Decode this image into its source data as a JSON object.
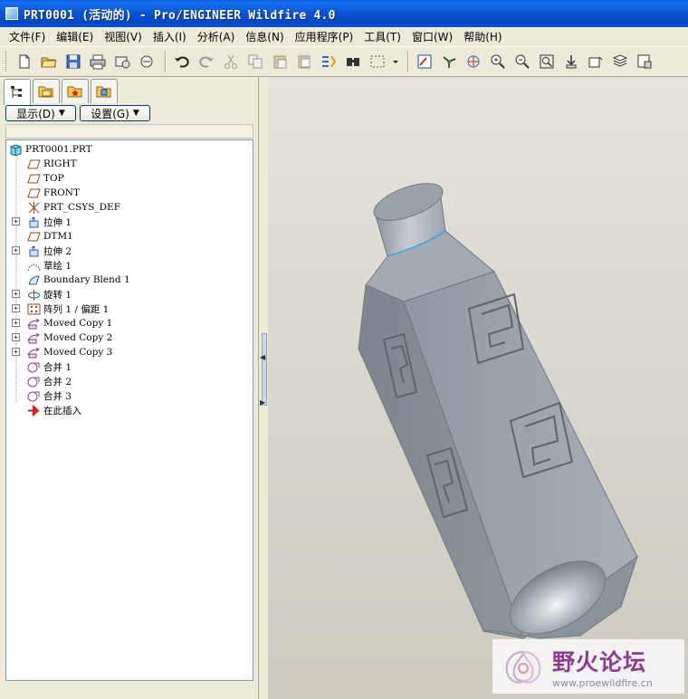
{
  "window": {
    "title": "PRT0001 (活动的) - Pro/ENGINEER Wildfire 4.0"
  },
  "menu": [
    {
      "label": "文件(F)"
    },
    {
      "label": "编辑(E)"
    },
    {
      "label": "视图(V)"
    },
    {
      "label": "插入(I)"
    },
    {
      "label": "分析(A)"
    },
    {
      "label": "信息(N)"
    },
    {
      "label": "应用程序(P)"
    },
    {
      "label": "工具(T)"
    },
    {
      "label": "窗口(W)"
    },
    {
      "label": "帮助(H)"
    }
  ],
  "toolbar_icons": [
    "new-icon",
    "open-icon",
    "save-icon",
    "print-icon",
    "send-icon",
    "email-icon",
    "undo-icon",
    "redo-icon",
    "cut-icon",
    "copy-icon",
    "paste-icon",
    "paste-special-icon",
    "regenerate-icon",
    "find-icon",
    "select-box-icon",
    "repaint-icon",
    "spin-center-icon",
    "orient-icon",
    "zoom-in-icon",
    "zoom-out-icon",
    "refit-icon",
    "reorient-icon",
    "saved-views-icon",
    "layers-icon",
    "view-manager-icon"
  ],
  "tree_controls": {
    "show_label": "显示(D)",
    "settings_label": "设置(G)"
  },
  "tree": {
    "root": "PRT0001.PRT",
    "items": [
      {
        "label": "RIGHT",
        "icon": "datum-plane-icon",
        "expandable": false
      },
      {
        "label": "TOP",
        "icon": "datum-plane-icon",
        "expandable": false
      },
      {
        "label": "FRONT",
        "icon": "datum-plane-icon",
        "expandable": false
      },
      {
        "label": "PRT_CSYS_DEF",
        "icon": "csys-icon",
        "expandable": false
      },
      {
        "label": "拉伸 1",
        "icon": "extrude-icon",
        "expandable": true
      },
      {
        "label": "DTM1",
        "icon": "datum-plane-icon",
        "expandable": false
      },
      {
        "label": "拉伸 2",
        "icon": "extrude-icon",
        "expandable": true
      },
      {
        "label": "草绘 1",
        "icon": "sketch-icon",
        "expandable": false
      },
      {
        "label": "Boundary Blend 1",
        "icon": "boundary-blend-icon",
        "expandable": false
      },
      {
        "label": "旋转 1",
        "icon": "revolve-icon",
        "expandable": true
      },
      {
        "label": "阵列 1 / 偏距 1",
        "icon": "pattern-icon",
        "expandable": true
      },
      {
        "label": "Moved Copy 1",
        "icon": "moved-copy-icon",
        "expandable": true
      },
      {
        "label": "Moved Copy 2",
        "icon": "moved-copy-icon",
        "expandable": true
      },
      {
        "label": "Moved Copy 3",
        "icon": "moved-copy-icon",
        "expandable": true
      },
      {
        "label": "合并 1",
        "icon": "merge-icon",
        "expandable": false
      },
      {
        "label": "合并 2",
        "icon": "merge-icon",
        "expandable": false
      },
      {
        "label": "合并 3",
        "icon": "merge-icon",
        "expandable": false
      },
      {
        "label": "在此插入",
        "icon": "insert-here-icon",
        "expandable": false
      }
    ]
  },
  "watermark": {
    "title": "野火论坛",
    "url": "www.proewildfire.cn"
  },
  "colors": {
    "title_bar": "#0b56d6",
    "model_gray": "#9aa3ab",
    "background": "#dcd8cf",
    "watermark_purple": "#8a3d8f"
  }
}
